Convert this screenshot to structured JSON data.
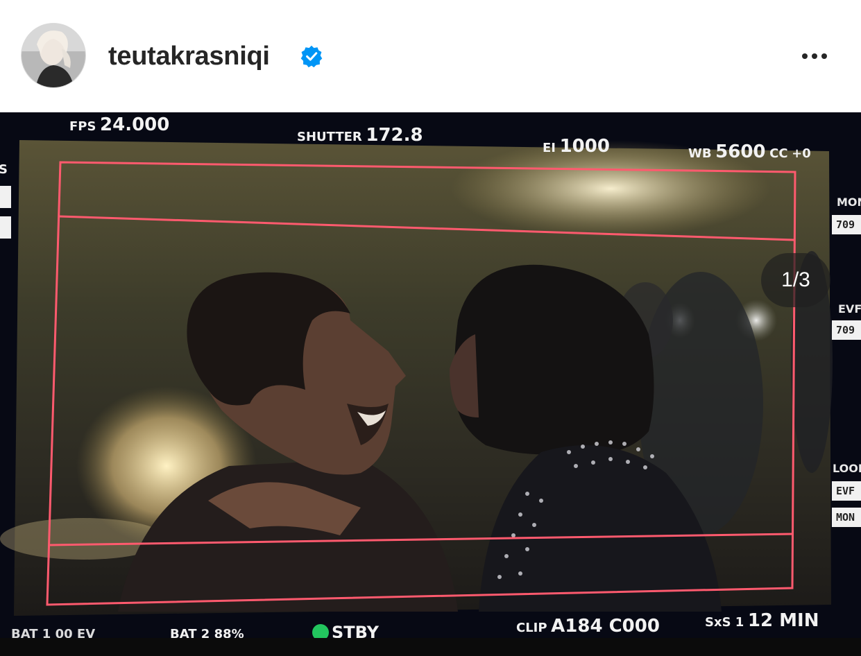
{
  "header": {
    "username": "teutakrasniqi",
    "verified_icon": "verified-badge-icon",
    "more_icon": "more-options-icon"
  },
  "post": {
    "counter": "1/3",
    "camera_hud": {
      "fps_label": "FPS",
      "fps_value": "24.000",
      "shutter_label": "SHUTTER",
      "shutter_value": "172.8",
      "ei_label": "EI",
      "ei_value": "1000",
      "wb_label": "WB",
      "wb_value": "5600",
      "cc_label": "CC",
      "cc_value": "+0",
      "left_edge": "S",
      "mon_label": "MON",
      "mon_value": "709",
      "evf_label": "EVF",
      "evf_value": "709",
      "look_label": "LOOK",
      "look_evf": "EVF",
      "look_mon": "MON",
      "bottom_left_partial": "BAT 1 00 EV",
      "bat_partial": "BAT 2 88%",
      "stby": "STBY",
      "clip_label": "CLIP",
      "clip_value": "A184 C000",
      "sxs_label": "SxS 1",
      "sxs_value": "12 MIN"
    },
    "colors": {
      "frame_lines": "#ff5a6e",
      "status_green": "#22c55e",
      "verified_blue": "#0095f6"
    }
  }
}
